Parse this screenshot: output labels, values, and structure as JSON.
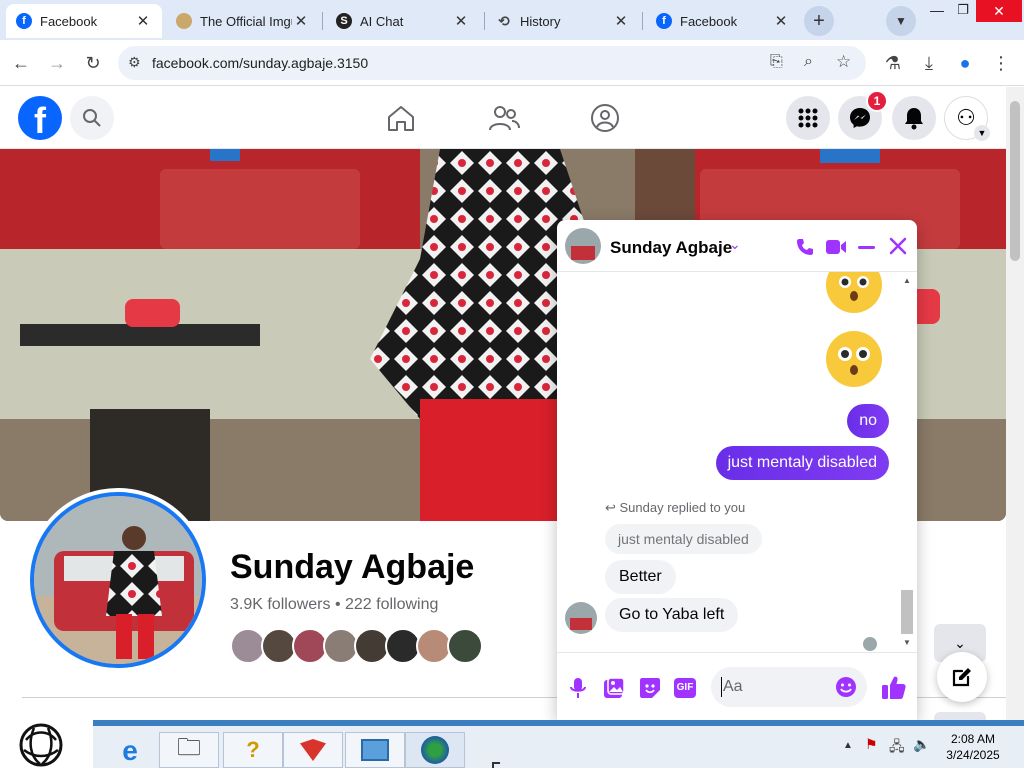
{
  "browser": {
    "tabs": [
      {
        "title": "Facebook",
        "active": true
      },
      {
        "title": "The Official Imgur",
        "active": false
      },
      {
        "title": "AI Chat",
        "active": false
      },
      {
        "title": "History",
        "active": false
      },
      {
        "title": "Facebook",
        "active": false
      }
    ],
    "new_tab": "+",
    "url": "facebook.com/sunday.agbaje.3150"
  },
  "facebook": {
    "messenger_badge": "1",
    "profile": {
      "name": "Sunday Agbaje",
      "followers_text": "3.9K followers • 222 following"
    }
  },
  "chat": {
    "contact_name": "Sunday Agbaje",
    "messages_out": [
      "no",
      "just mentaly disabled"
    ],
    "reply_note": "Sunday replied to you",
    "quoted": "just mentaly disabled",
    "messages_in": [
      "Better",
      "Go to Yaba left"
    ],
    "input_placeholder": "Aa"
  },
  "taskbar": {
    "time": "2:08 AM",
    "date": "3/24/2025"
  },
  "colors": {
    "facebook_blue": "#0866ff",
    "messenger_purple": "#a033ff",
    "badge_red": "#e41e3f"
  }
}
